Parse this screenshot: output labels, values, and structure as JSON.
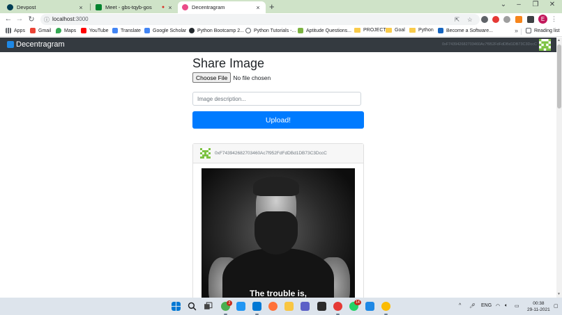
{
  "browser": {
    "tabs": [
      {
        "title": "Devpost",
        "active": false
      },
      {
        "title": "Meet - gbs-tqyb-gos",
        "active": false
      },
      {
        "title": "Decentragram",
        "active": true
      }
    ],
    "new_tab_glyph": "+",
    "close_glyph": "×",
    "window_controls": {
      "dropdown": "⌄",
      "minimize": "–",
      "maximize": "❐",
      "close": "✕"
    },
    "nav": {
      "back": "←",
      "forward": "→",
      "reload": "↻"
    },
    "address": {
      "host": "localhost",
      "port": ":3000",
      "info_glyph": "ⓘ"
    },
    "bookmarks": [
      {
        "label": "Apps",
        "icon": "apps-grid-icon"
      },
      {
        "label": "Gmail",
        "icon": "gmail-icon"
      },
      {
        "label": "Maps",
        "icon": "maps-icon"
      },
      {
        "label": "YouTube",
        "icon": "youtube-icon"
      },
      {
        "label": "Translate",
        "icon": "translate-icon"
      },
      {
        "label": "Google Scholar",
        "icon": "scholar-icon"
      },
      {
        "label": "Python Bootcamp 2...",
        "icon": "github-icon"
      },
      {
        "label": "Python Tutorials -...",
        "icon": "site-icon"
      },
      {
        "label": "Aptitude Questions...",
        "icon": "site-icon"
      },
      {
        "label": "PROJECT",
        "icon": "folder-icon"
      },
      {
        "label": "Goal",
        "icon": "folder-icon"
      },
      {
        "label": "Python",
        "icon": "folder-icon"
      },
      {
        "label": "Become a Software...",
        "icon": "site-icon"
      }
    ],
    "bookmarks_more": "»",
    "reading_list": "Reading list",
    "profile_initial": "E",
    "menu_glyph": "⋮"
  },
  "app": {
    "brand": "Decentragram",
    "account": "0xF743942682703460Ac7f952FdFdDBd1DB73C3DccC",
    "share_title": "Share Image",
    "choose_file_label": "Choose File",
    "file_status": "No file chosen",
    "description_placeholder": "Image description...",
    "upload_label": "Upload!",
    "post": {
      "author": "0xF743942682703460Ac7f952FdFdDBd1DB73C3DccC",
      "caption": "The trouble is,"
    }
  },
  "taskbar": {
    "language": "ENG",
    "time": "00:38",
    "date": "29-11-2021",
    "tray_chevron": "^",
    "badges": {
      "chrome_work": "2",
      "whatsapp": "14"
    }
  },
  "colors": {
    "tab_strip": "#cfe3c8",
    "navbar": "#343a40",
    "primary": "#007bff",
    "taskbar": "#dde4ec"
  }
}
